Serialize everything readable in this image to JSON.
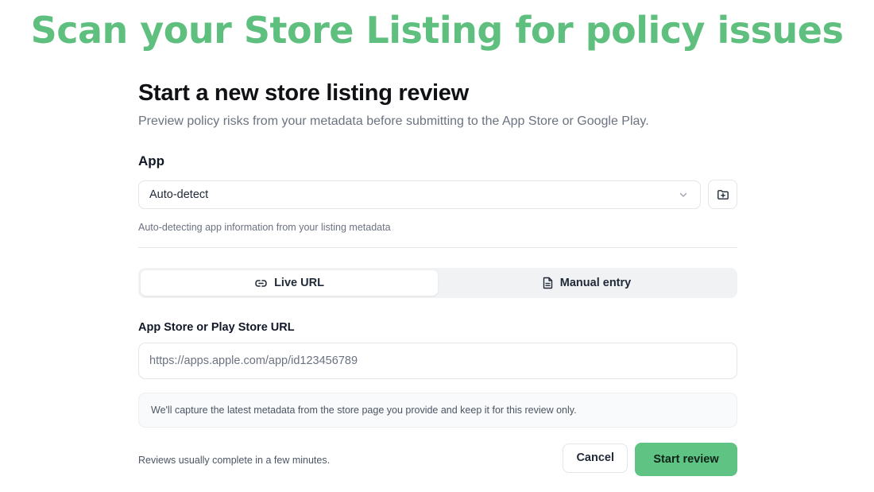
{
  "banner": {
    "text": "Scan your Store Listing for policy issues"
  },
  "header": {
    "title": "Start a new store listing review",
    "subtitle": "Preview policy risks from your metadata before submitting to the App Store or Google Play."
  },
  "app_section": {
    "label": "App",
    "selected": "Auto-detect",
    "hint": "Auto-detecting app information from your listing metadata"
  },
  "tabs": [
    {
      "label": "Live URL",
      "icon": "link-icon",
      "active": true
    },
    {
      "label": "Manual entry",
      "icon": "document-icon",
      "active": false
    }
  ],
  "url_field": {
    "label": "App Store or Play Store URL",
    "placeholder": "https://apps.apple.com/app/id123456789",
    "value": ""
  },
  "notice": "We'll capture the latest metadata from the store page you provide and keep it for this review only.",
  "footer": {
    "note": "Reviews usually complete in a few minutes.",
    "cancel_label": "Cancel",
    "start_label": "Start review"
  },
  "colors": {
    "banner": "#5fbf7e",
    "primary_button": "#5fc383",
    "border": "#e3e5e8",
    "muted_text": "#6b7280"
  }
}
